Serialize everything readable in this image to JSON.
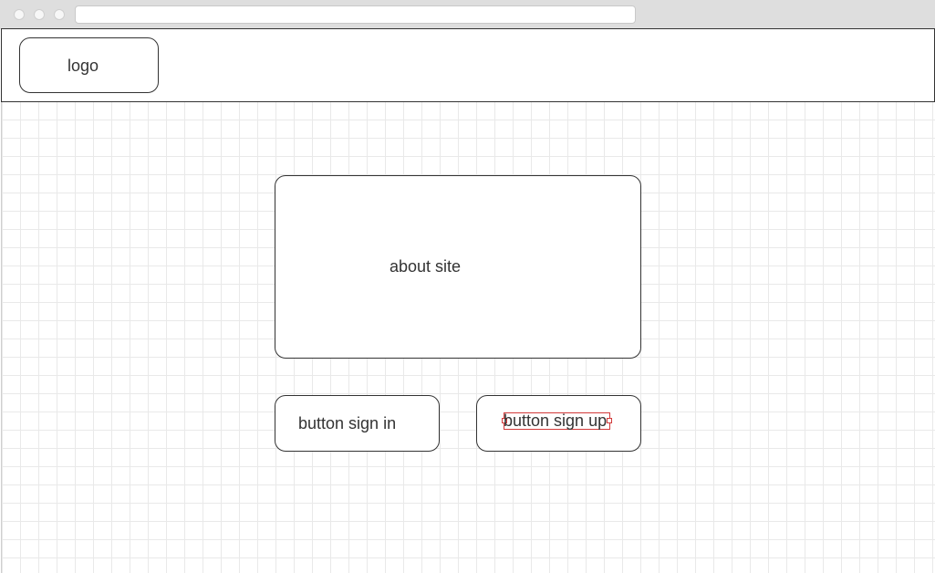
{
  "header": {
    "logo_label": "logo"
  },
  "main": {
    "about_label": "about site",
    "sign_in_label": "button sign in",
    "sign_up_label": "button sign up"
  },
  "colors": {
    "selection": "#d23a3a",
    "stroke": "#333333",
    "grid": "#e9e9e9"
  }
}
